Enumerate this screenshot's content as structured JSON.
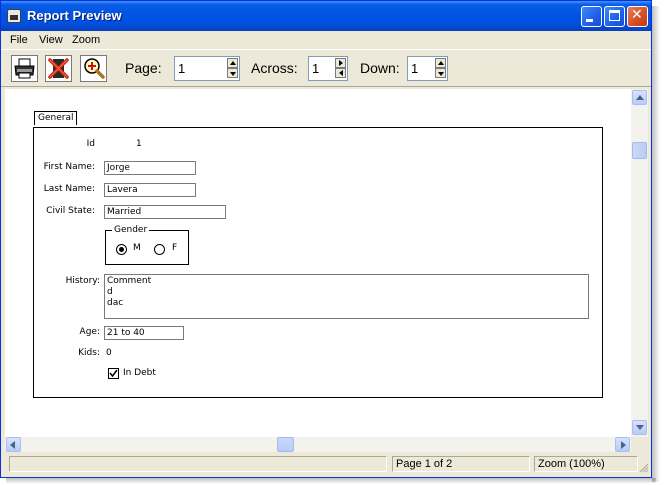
{
  "window": {
    "title": "Report Preview"
  },
  "menu": [
    "File",
    "View",
    "Zoom"
  ],
  "toolbar": {
    "page_label": "Page:",
    "page_value": "1",
    "across_label": "Across:",
    "across_value": "1",
    "down_label": "Down:",
    "down_value": "1",
    "print_icon": "printer-icon",
    "close_icon": "close-preview-icon",
    "zoom_icon": "zoom-in-icon"
  },
  "form": {
    "tab_label": "General",
    "id_label": "Id",
    "id_value": "1",
    "first_name_label": "First Name:",
    "first_name_value": "Jorge",
    "last_name_label": "Last Name:",
    "last_name_value": "Lavera",
    "civil_state_label": "Civil State:",
    "civil_state_value": "Married",
    "gender_title": "Gender",
    "gender_options": [
      "M",
      "F"
    ],
    "gender_selected": "M",
    "history_label": "History:",
    "history_lines": [
      "Comment",
      "d",
      "dac"
    ],
    "age_label": "Age:",
    "age_value": "21 to 40",
    "kids_label": "Kids:",
    "kids_value": "0",
    "in_debt_label": "In Debt",
    "in_debt_checked": true
  },
  "status": {
    "page_info": "Page 1 of 2",
    "zoom_info": "Zoom (100%)"
  },
  "colors": {
    "title_bar": "#0054e3",
    "chrome": "#ece9d8",
    "close_button": "#d64c22"
  }
}
